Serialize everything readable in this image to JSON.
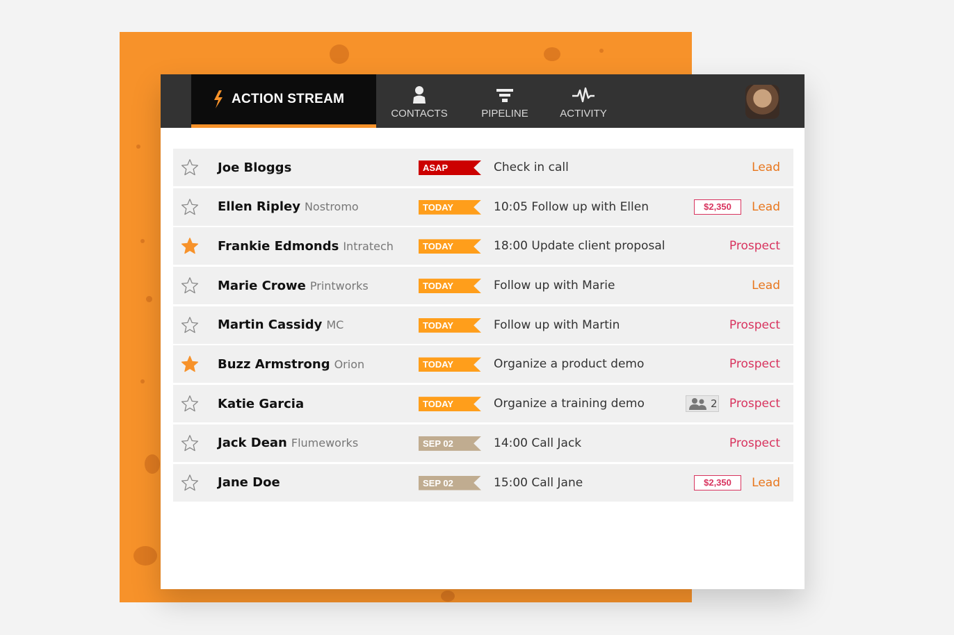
{
  "colors": {
    "accent": "#f7922a",
    "asap": "#cc0000",
    "today": "#ff9e1b",
    "future": "#c0ac90",
    "lead": "#e8761c",
    "prospect": "#d8335e"
  },
  "nav": {
    "active": {
      "label": "ACTION STREAM",
      "icon": "bolt-icon"
    },
    "tabs": [
      {
        "label": "CONTACTS",
        "icon": "person-icon"
      },
      {
        "label": "PIPELINE",
        "icon": "funnel-icon"
      },
      {
        "label": "ACTIVITY",
        "icon": "pulse-icon"
      }
    ],
    "avatar": "user-avatar"
  },
  "rows": [
    {
      "starred": false,
      "name": "Joe Bloggs",
      "company": "",
      "tag": "ASAP",
      "tag_type": "asap",
      "task": "Check in call",
      "amount": "",
      "people": "",
      "stage": "Lead",
      "stage_type": "lead"
    },
    {
      "starred": false,
      "name": "Ellen Ripley",
      "company": "Nostromo",
      "tag": "TODAY",
      "tag_type": "today",
      "task": "10:05 Follow up with Ellen",
      "amount": "$2,350",
      "people": "",
      "stage": "Lead",
      "stage_type": "lead"
    },
    {
      "starred": true,
      "name": "Frankie Edmonds",
      "company": "Intratech",
      "tag": "TODAY",
      "tag_type": "today",
      "task": "18:00 Update client proposal",
      "amount": "",
      "people": "",
      "stage": "Prospect",
      "stage_type": "prospect"
    },
    {
      "starred": false,
      "name": "Marie Crowe",
      "company": "Printworks",
      "tag": "TODAY",
      "tag_type": "today",
      "task": "Follow up with Marie",
      "amount": "",
      "people": "",
      "stage": "Lead",
      "stage_type": "lead"
    },
    {
      "starred": false,
      "name": "Martin Cassidy",
      "company": "MC",
      "tag": "TODAY",
      "tag_type": "today",
      "task": "Follow up with Martin",
      "amount": "",
      "people": "",
      "stage": "Prospect",
      "stage_type": "prospect"
    },
    {
      "starred": true,
      "name": "Buzz Armstrong",
      "company": "Orion",
      "tag": "TODAY",
      "tag_type": "today",
      "task": "Organize a product demo",
      "amount": "",
      "people": "",
      "stage": "Prospect",
      "stage_type": "prospect"
    },
    {
      "starred": false,
      "name": "Katie Garcia",
      "company": "",
      "tag": "TODAY",
      "tag_type": "today",
      "task": "Organize a training demo",
      "amount": "",
      "people": "2",
      "stage": "Prospect",
      "stage_type": "prospect"
    },
    {
      "starred": false,
      "name": "Jack Dean",
      "company": "Flumeworks",
      "tag": "SEP 02",
      "tag_type": "future",
      "task": "14:00 Call Jack",
      "amount": "",
      "people": "",
      "stage": "Prospect",
      "stage_type": "prospect"
    },
    {
      "starred": false,
      "name": "Jane Doe",
      "company": "",
      "tag": "SEP 02",
      "tag_type": "future",
      "task": "15:00 Call Jane",
      "amount": "$2,350",
      "people": "",
      "stage": "Lead",
      "stage_type": "lead"
    }
  ]
}
